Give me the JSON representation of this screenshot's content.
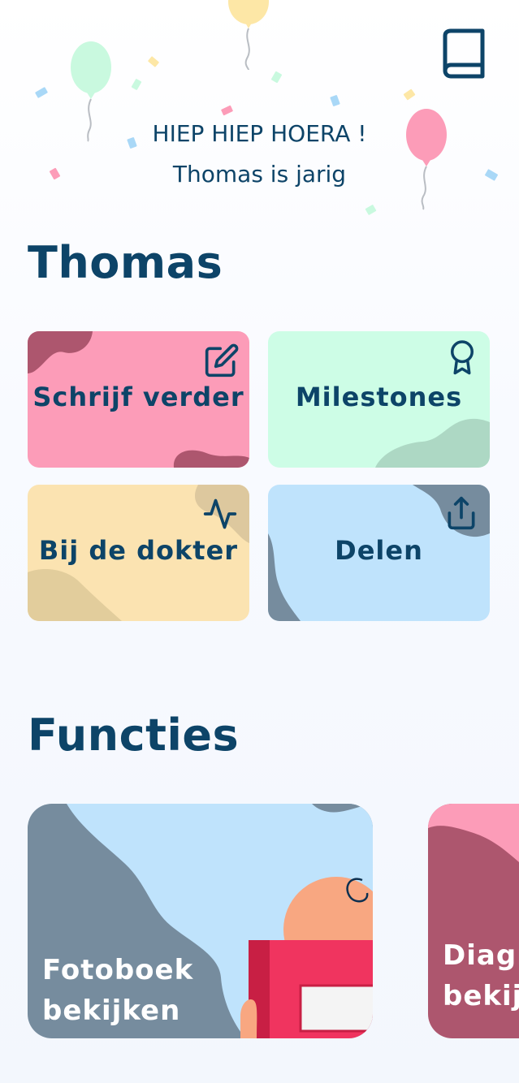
{
  "header": {
    "line1": "HIEP HIEP HOERA !",
    "line2": "Thomas is jarig"
  },
  "profile": {
    "name": "Thomas"
  },
  "tiles": [
    {
      "label": "Schrijf verder",
      "icon": "edit-icon",
      "color": "#fc9cb8"
    },
    {
      "label": "Milestones",
      "icon": "award-icon",
      "color": "#cdfde6"
    },
    {
      "label": "Bij de dokter",
      "icon": "activity-icon",
      "color": "#fbe3b1"
    },
    {
      "label": "Delen",
      "icon": "share-icon",
      "color": "#bfe3fc"
    }
  ],
  "functions": {
    "title": "Functies",
    "cards": [
      {
        "line1": "Fotoboek",
        "line2": "bekijken"
      },
      {
        "line1": "Diagr",
        "line2": "bekijk"
      }
    ]
  },
  "colors": {
    "primary": "#0d4468",
    "pink": "#fc9cb8",
    "mint": "#cdfde6",
    "yellow": "#fbe3b1",
    "blue": "#bfe3fc",
    "slate": "#768c9e",
    "berry": "#ad566e"
  }
}
